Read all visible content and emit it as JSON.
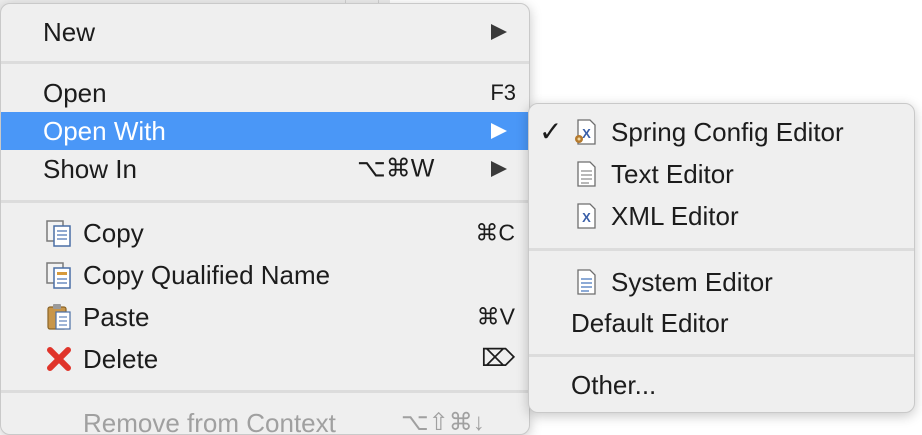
{
  "context_menu": {
    "new": {
      "label": "New"
    },
    "open": {
      "label": "Open",
      "shortcut": "F3"
    },
    "open_with": {
      "label": "Open With"
    },
    "show_in": {
      "label": "Show In",
      "shortcut": "⌥⌘W"
    },
    "copy": {
      "label": "Copy",
      "shortcut": "⌘C"
    },
    "copy_qualified_name": {
      "label": "Copy Qualified Name"
    },
    "paste": {
      "label": "Paste",
      "shortcut": "⌘V"
    },
    "delete": {
      "label": "Delete",
      "shortcut": "⌦"
    },
    "partially_visible": {
      "label": "Remove from Context",
      "shortcut": "⌥⇧⌘↓"
    }
  },
  "open_with_submenu": {
    "spring_config_editor": {
      "label": "Spring Config Editor",
      "checked": true,
      "check_glyph": "✓"
    },
    "text_editor": {
      "label": "Text Editor"
    },
    "xml_editor": {
      "label": "XML Editor"
    },
    "system_editor": {
      "label": "System Editor"
    },
    "default_editor": {
      "label": "Default Editor"
    },
    "other": {
      "label": "Other..."
    }
  },
  "colors": {
    "menu_bg": "#efefef",
    "highlight": "#4a97f7",
    "delete_icon": "#e0342a"
  }
}
